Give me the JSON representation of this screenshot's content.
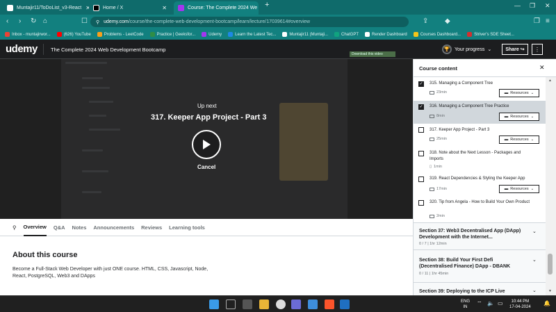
{
  "browser": {
    "tabs": [
      {
        "title": "Muntajir11/ToDoList_v3-React",
        "active": false
      },
      {
        "title": "Home / X",
        "active": false
      },
      {
        "title": "Course: The Complete 2024 We",
        "active": true
      }
    ],
    "new_tab": "+",
    "url_domain": "udemy.com",
    "url_path": "/course/the-complete-web-development-bootcamp/learn/lecture/17039614#overview",
    "bookmarks": [
      {
        "label": "Inbox - muntajirwor...",
        "color": "#ea4335"
      },
      {
        "label": "(626) YouTube",
        "color": "#ff0000"
      },
      {
        "label": "Problems - LeetCode",
        "color": "#f89f1b"
      },
      {
        "label": "Practice | Geeksfor...",
        "color": "#2f8d46"
      },
      {
        "label": "Udemy",
        "color": "#a435f0"
      },
      {
        "label": "Learn the Latest Tec...",
        "color": "#1e88e5"
      },
      {
        "label": "Muntajir11 (Muntaji...",
        "color": "#ffffff"
      },
      {
        "label": "ChatGPT",
        "color": "#10a37f"
      },
      {
        "label": "Render Dashboard",
        "color": "#ffffff"
      },
      {
        "label": "Courses Dashboard...",
        "color": "#f5c518"
      },
      {
        "label": "Striver's SDE Sheet...",
        "color": "#d32f2f"
      }
    ]
  },
  "header": {
    "logo": "udemy",
    "course_title": "The Complete 2024 Web Development Bootcamp",
    "progress_label": "Your progress",
    "share_label": "Share",
    "more_label": "⋮"
  },
  "player": {
    "up_next": "Up next",
    "next_title": "317. Keeper App Project - Part 3",
    "cancel": "Cancel",
    "download_label": "Download this video"
  },
  "tabs": [
    "Overview",
    "Q&A",
    "Notes",
    "Announcements",
    "Reviews",
    "Learning tools"
  ],
  "about": {
    "heading": "About this course",
    "description": "Become a Full-Stack Web Developer with just ONE course. HTML, CSS, Javascript, Node, React, PostgreSQL, Web3 and DApps"
  },
  "sidebar": {
    "title": "Course content",
    "close": "✕",
    "lectures": [
      {
        "title": "315. Managing a Component Tree",
        "duration": "23min",
        "checked": true,
        "resources": "Resources",
        "selected": false
      },
      {
        "title": "316. Managing a Component Tree Practice",
        "duration": "8min",
        "checked": true,
        "resources": "Resources",
        "selected": true
      },
      {
        "title": "317. Keeper App Project - Part 3",
        "duration": "25min",
        "checked": false,
        "resources": "Resources",
        "selected": false
      },
      {
        "title": "318. Note about the Next Lesson - Packages and Imports",
        "duration": "1min",
        "checked": false,
        "resources": "",
        "selected": false
      },
      {
        "title": "319. React Dependencies & Styling the Keeper App",
        "duration": "17min",
        "checked": false,
        "resources": "Resources",
        "selected": false
      },
      {
        "title": "320. Tip from Angela - How to Build Your Own Product",
        "duration": "2min",
        "checked": false,
        "resources": "",
        "selected": false
      }
    ],
    "sections": [
      {
        "title": "Section 37: Web3 Decentralised App (DApp) Development with the Internet...",
        "meta": "0 / 7 | 1hr 12min"
      },
      {
        "title": "Section 38: Build Your First Defi (Decentralised Finance) DApp - DBANK",
        "meta": "0 / 11 | 1hr 45min"
      },
      {
        "title": "Section 39: Deploying to the ICP Live",
        "meta": ""
      }
    ]
  },
  "taskbar": {
    "lang": "ENG",
    "region": "IN",
    "time": "10:44 PM",
    "date": "17-04-2024"
  }
}
